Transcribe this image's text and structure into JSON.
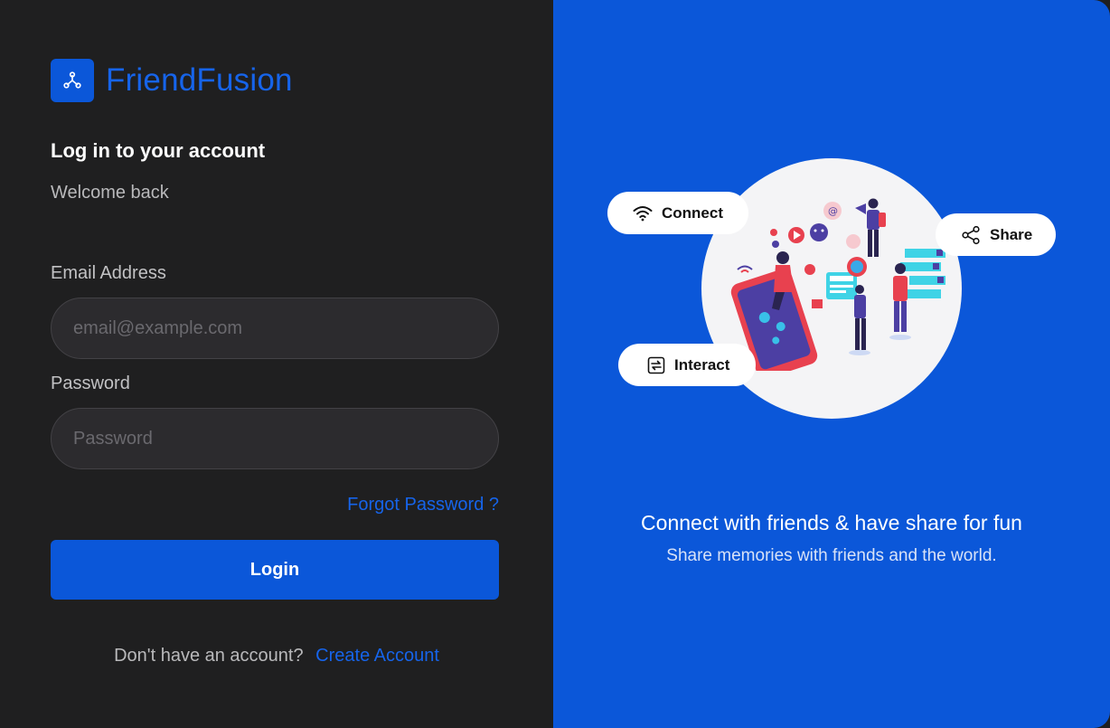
{
  "brand": {
    "name": "FriendFusion",
    "logo_icon": "network-nodes-icon"
  },
  "login": {
    "heading": "Log in to your account",
    "subheading": "Welcome back",
    "email_label": "Email Address",
    "email_placeholder": "email@example.com",
    "email_value": "",
    "password_label": "Password",
    "password_placeholder": "Password",
    "password_value": "",
    "forgot_label": "Forgot Password ?",
    "login_button": "Login",
    "signup_prompt": "Don't have an account?",
    "signup_link": "Create Account"
  },
  "hero": {
    "pills": {
      "connect": {
        "label": "Connect",
        "icon": "wifi-icon"
      },
      "share": {
        "label": "Share",
        "icon": "share-icon"
      },
      "interact": {
        "label": "Interact",
        "icon": "repeat-icon"
      }
    },
    "tagline": "Connect with friends & have share for fun",
    "subtagline": "Share memories with friends and the world."
  },
  "colors": {
    "accent": "#0b57d9",
    "link": "#1664ea",
    "left_background": "#1f1f20",
    "input_background": "#2c2b2e"
  }
}
